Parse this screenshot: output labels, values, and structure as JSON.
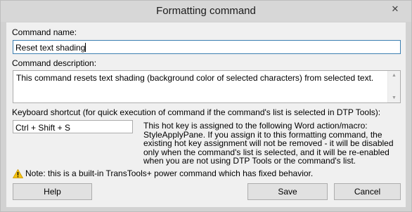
{
  "window": {
    "title": "Formatting command",
    "close_glyph": "✕"
  },
  "command_name": {
    "label": "Command name:",
    "value": "Reset text shading"
  },
  "command_description": {
    "label": "Command description:",
    "value": "This command resets text shading (background color of selected characters) from selected text."
  },
  "keyboard_shortcut": {
    "label": "Keyboard shortcut (for quick execution of command if the command's list is selected in DTP Tools):",
    "value": "Ctrl + Shift + S",
    "info": "This hot key is assigned to the following Word action/macro: StyleApplyPane. If you assign it to this formatting command, the existing hot key assignment will not be removed - it will be disabled only when the command's list is selected, and it will be re-enabled when you are not using DTP Tools or the command's list."
  },
  "note": {
    "icon": "warning-icon",
    "text": "Note: this is a built-in TransTools+ power command which has fixed behavior."
  },
  "buttons": {
    "help": "Help",
    "save": "Save",
    "cancel": "Cancel"
  },
  "colors": {
    "warning": "#f5c211",
    "focus_border": "#3c7fb1"
  }
}
